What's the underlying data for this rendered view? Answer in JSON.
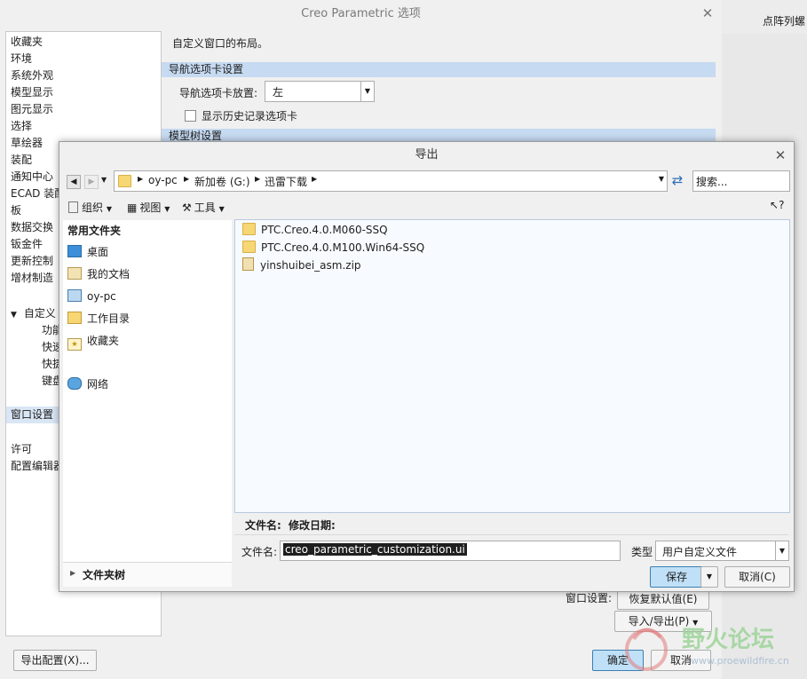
{
  "options_window": {
    "title": "Creo Parametric 选项",
    "close": "✕",
    "categories": [
      "收藏夹",
      "环境",
      "系统外观",
      "模型显示",
      "图元显示",
      "选择",
      "草绘器",
      "装配",
      "通知中心",
      "ECAD 装配",
      "板",
      "数据交换",
      "钣金件",
      "更新控制",
      "增材制造"
    ],
    "customize_group": "自定义",
    "customize_children": [
      "功能",
      "快速",
      "快捷",
      "键盘"
    ],
    "window_settings": "窗口设置",
    "license": "许可",
    "config_editor": "配置编辑器",
    "main_heading": "自定义窗口的布局。",
    "nav_section": "导航选项卡设置",
    "nav_placement_label": "导航选项卡放置:",
    "nav_placement_value": "左",
    "show_history_label": "显示历史记录选项卡",
    "model_tree_section": "模型树设置",
    "window_settings_label": "窗口设置:",
    "restore_defaults": "恢复默认值(E)",
    "import_export": "导入/导出(P)",
    "export_config": "导出配置(X)...",
    "ok": "确定",
    "cancel": "取消"
  },
  "right_strip": {
    "text": "点阵列螺"
  },
  "export_dialog": {
    "title": "导出",
    "close": "✕",
    "breadcrumb": [
      "oy-pc",
      "新加卷 (G:)",
      "迅雷下载"
    ],
    "search_placeholder": "搜索...",
    "toolbar": {
      "organize": "组织",
      "view": "视图",
      "tools": "工具"
    },
    "help": "?",
    "nav_header": "常用文件夹",
    "nav_items": [
      "桌面",
      "我的文档",
      "oy-pc",
      "工作目录",
      "收藏夹",
      "网络"
    ],
    "folder_tree": "文件夹树",
    "files": [
      {
        "name": "PTC.Creo.4.0.M060-SSQ",
        "type": "folder"
      },
      {
        "name": "PTC.Creo.4.0.M100.Win64-SSQ",
        "type": "folder"
      },
      {
        "name": "yinshuibei_asm.zip",
        "type": "zip"
      }
    ],
    "info_label_name": "文件名:",
    "info_label_date": "修改日期:",
    "filename_label": "文件名:",
    "filename_value": "creo_parametric_customization.ui",
    "type_label": "类型",
    "type_value": "用户自定义文件",
    "save": "保存",
    "cancel": "取消(C)"
  },
  "watermark": {
    "text": "野火论坛",
    "url": "www.proewildfire.cn"
  },
  "colors": {
    "section": "#c6daf1",
    "save_btn": "#bfe0f7",
    "accent": "#2e6db6"
  }
}
